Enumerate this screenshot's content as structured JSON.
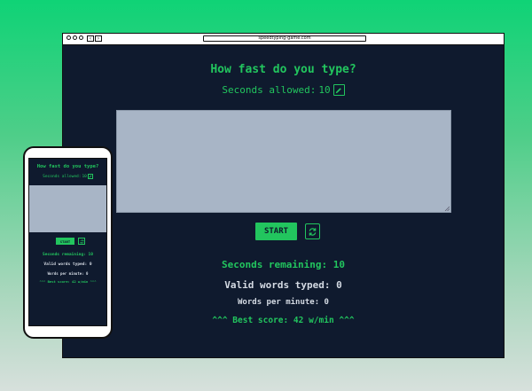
{
  "browser": {
    "url": "speedtyping-game.com",
    "back_glyph": "‹",
    "forward_glyph": "›"
  },
  "game": {
    "title": "How fast do you type?",
    "seconds_allowed_label": "Seconds allowed:",
    "seconds_allowed_value": "10",
    "start_label": "START",
    "seconds_remaining": "Seconds remaining: 10",
    "valid_words": "Valid words typed: 0",
    "wpm": "Words per minute: 0",
    "best_score": "^^^ Best score: 42 w/min ^^^"
  },
  "phone": {
    "title": "How fast do you type?",
    "seconds_allowed_label": "Seconds allowed:",
    "seconds_allowed_value": "10",
    "start_label": "START",
    "seconds_remaining": "Seconds remaining: 10",
    "valid_words": "Valid words typed: 0",
    "wpm": "Words per minute: 0",
    "best_score": "^^^ Best score: 42 w/min ^^^"
  },
  "colors": {
    "accent": "#22c55e",
    "background": "#0f1a2e",
    "textarea": "#a8b5c6",
    "muted_text": "#d4dae3"
  },
  "icons": {
    "edit": "pencil-icon",
    "reset": "refresh-icon"
  }
}
